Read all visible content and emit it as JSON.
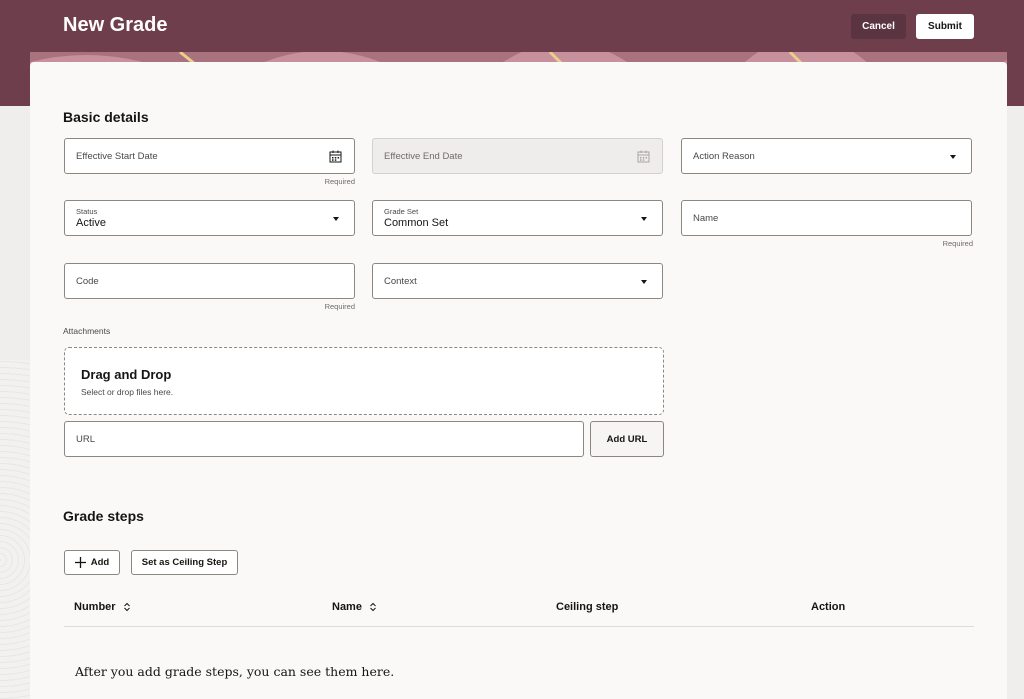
{
  "header": {
    "title": "New Grade",
    "cancel_label": "Cancel",
    "submit_label": "Submit"
  },
  "basic_details": {
    "title": "Basic details",
    "effective_start_date": {
      "label": "Effective Start Date",
      "helper": "Required"
    },
    "effective_end_date": {
      "label": "Effective End Date"
    },
    "action_reason": {
      "label": "Action Reason"
    },
    "status": {
      "label": "Status",
      "value": "Active"
    },
    "grade_set": {
      "label": "Grade Set",
      "value": "Common Set"
    },
    "name": {
      "label": "Name",
      "helper": "Required"
    },
    "code": {
      "label": "Code",
      "helper": "Required"
    },
    "context": {
      "label": "Context"
    },
    "attachments": {
      "label": "Attachments",
      "drop_title": "Drag and Drop",
      "drop_subtitle": "Select or drop files here.",
      "url_label": "URL",
      "add_url_label": "Add URL"
    }
  },
  "grade_steps": {
    "title": "Grade steps",
    "add_label": "Add",
    "ceiling_label": "Set as Ceiling Step",
    "columns": [
      "Number",
      "Name",
      "Ceiling step",
      "Action"
    ],
    "empty_message": "After you add grade steps, you can see them here."
  },
  "colors": {
    "header_bg": "#6f3e4c",
    "card_bg": "#fbf9f8",
    "page_bg": "#efeeec"
  },
  "icons": [
    "calendar-icon",
    "chevron-down-icon",
    "plus-icon",
    "sort-icon"
  ]
}
